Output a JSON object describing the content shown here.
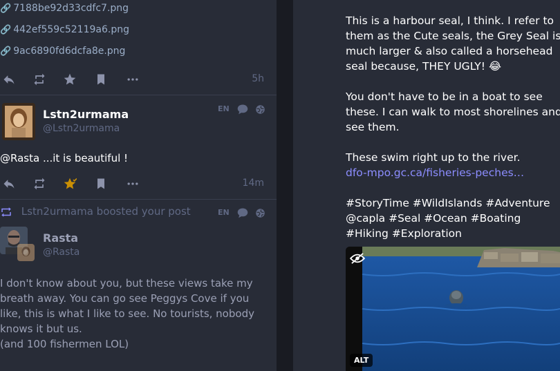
{
  "left": {
    "attachments": [
      "7188be92d33cdfc7.png",
      "442ef559c52119a6.png",
      "9ac6890fd6dcfa8e.png"
    ],
    "post1": {
      "time": "5h"
    },
    "post2": {
      "display_name": "Lstn2urmama",
      "acct": "@Lstn2urmama",
      "lang": "EN",
      "text": "@Rasta ...it is beautiful !",
      "time": "14m"
    },
    "boost": {
      "booster": "Lstn2urmama",
      "label": " boosted your post",
      "lang": "EN",
      "display_name": "Rasta",
      "acct": "@Rasta",
      "text": [
        "I don't know about you, but these views take my breath away. You can go see Peggys Cove if you like, this is what I like to see. No tourists, nobody knows it but us.",
        "(and 100 fishermen LOL)"
      ]
    }
  },
  "right": {
    "para1": "This is a harbour seal, I think. I refer to them as the Cute seals, the Grey Seal is much larger & also called a horsehead seal because, THEY UGLY! 😂",
    "para2": "You don't have to be in a boat to see these. I can walk to most shorelines and see them.",
    "para3": "These swim right up to the river.",
    "link": "dfo-mpo.gc.ca/fisheries-peches…",
    "hashtags": "#StoryTime #WildIslands #Adventure @capla #Seal #Ocean #Boating #Hiking #Exploration",
    "alt_label": "ALT"
  },
  "icons": {
    "attachment": "paperclip-icon",
    "reply": "reply-icon",
    "boost": "retweet-icon",
    "favourite": "star-icon",
    "bookmark": "bookmark-icon",
    "more": "ellipsis-icon",
    "reply_all": "comment-icon",
    "globe": "globe-icon",
    "hide": "eye-slash-icon"
  },
  "colors": {
    "accent": "#8c8dff",
    "favourited": "#ca8f04",
    "muted": "#606984",
    "background": "#282c37"
  }
}
